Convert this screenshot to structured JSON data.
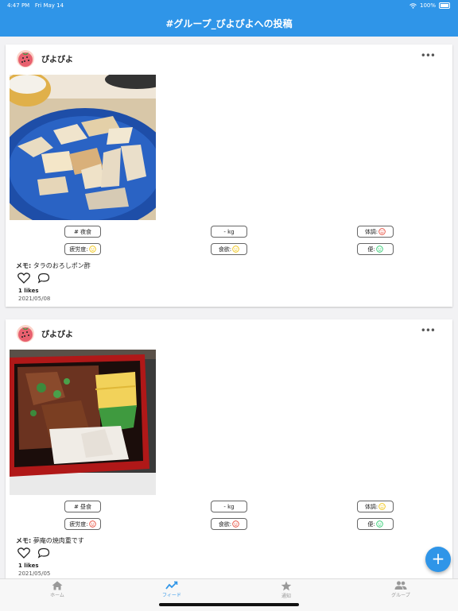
{
  "status_bar": {
    "time": "4:47 PM",
    "date": "Fri May 14",
    "battery": "100%"
  },
  "header": {
    "title": "#グループ_ぴよぴよへの投稿"
  },
  "posts": [
    {
      "user": "ぴよぴよ",
      "meal_tag": "# 夜食",
      "weight": "- kg",
      "condition_label": "体調:",
      "fatigue_label": "疲労度:",
      "appetite_label": "食欲:",
      "stool_label": "便:",
      "memo_label": "メモ:",
      "memo": "タラのおろしポン酢",
      "likes": "1 likes",
      "date": "2021/05/08"
    },
    {
      "user": "ぴよぴよ",
      "meal_tag": "# 昼食",
      "weight": "- kg",
      "condition_label": "体調:",
      "fatigue_label": "疲労度:",
      "appetite_label": "食欲:",
      "stool_label": "便:",
      "memo_label": "メモ:",
      "memo": "夢庵の焼肉重です",
      "likes": "1 likes",
      "date": "2021/05/05"
    }
  ],
  "fab": {
    "label": "+"
  },
  "tabbar": {
    "items": [
      {
        "label": "ホーム",
        "icon": "home-icon"
      },
      {
        "label": "フィード",
        "icon": "feed-chart-icon"
      },
      {
        "label": "通知",
        "icon": "star-icon"
      },
      {
        "label": "グループ",
        "icon": "group-icon"
      }
    ]
  },
  "colors": {
    "accent": "#2f95e8",
    "face_red": "#e74c3c",
    "face_yellow": "#f1c40f",
    "face_green": "#2ecc71"
  }
}
